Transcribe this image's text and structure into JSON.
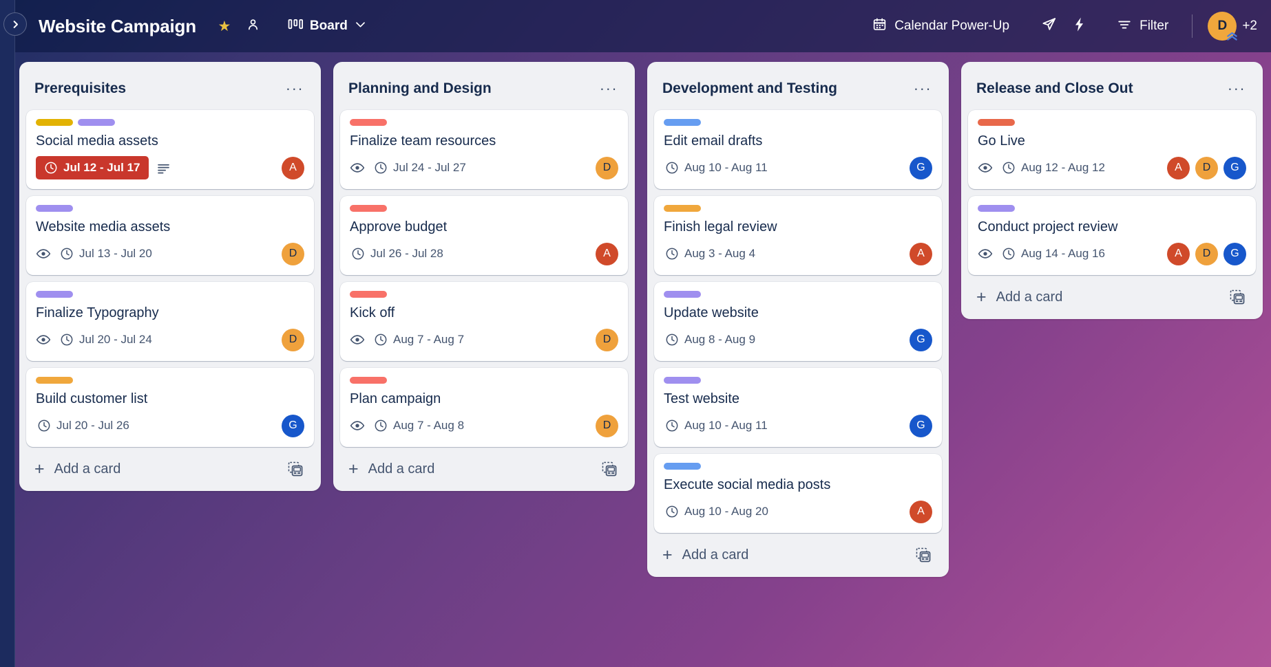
{
  "header": {
    "board_title": "Website Campaign",
    "star_icon": "star-icon",
    "visibility_icon": "workspace-visible-icon",
    "view_switcher_icon": "board-view-icon",
    "view_switcher_label": "Board",
    "view_switcher_chevron": "chevron-down-icon",
    "calendar_powerup_icon": "calendar-icon",
    "calendar_powerup_label": "Calendar Power-Up",
    "rocket_icon": "rocket-icon",
    "automation_icon": "lightning-bolt-icon",
    "filter_icon": "filter-icon",
    "filter_label": "Filter",
    "avatar_initial": "D",
    "avatar_color": "#f0a73c",
    "member_overflow": "+2",
    "premium_badge_icon": "premium-chevrons-icon"
  },
  "sidebar": {
    "expand_icon": "chevron-right-icon"
  },
  "colors": {
    "label_yellow": "#e2b203",
    "label_purple": "#9f8fef",
    "label_salmon": "#f87168",
    "label_coral": "#e8684a",
    "label_orange": "#f0a73c",
    "label_blue": "#669df1",
    "avatar_red": "#d04a2a",
    "avatar_orange": "#efa13c",
    "avatar_blue": "#1757cb",
    "due_overdue_bg": "#c9372c"
  },
  "board": {
    "add_card_label": "Add a card",
    "add_card_plus": "+",
    "card_template_icon": "card-template-icon",
    "list_menu_icon": "list-actions-icon",
    "lists": [
      {
        "title": "Prerequisites",
        "cards": [
          {
            "title": "Social media assets",
            "labels": [
              "#e2b203",
              "#9f8fef"
            ],
            "watching": false,
            "due": "Jul 12 - Jul 17",
            "due_state": "overdue",
            "description": true,
            "members": [
              {
                "initial": "A",
                "color": "#d04a2a",
                "text": "#ffffff"
              }
            ]
          },
          {
            "title": "Website media assets",
            "labels": [
              "#9f8fef"
            ],
            "watching": true,
            "due": "Jul 13 - Jul 20",
            "due_state": "normal",
            "description": false,
            "members": [
              {
                "initial": "D",
                "color": "#efa13c",
                "text": "#172b4d"
              }
            ]
          },
          {
            "title": "Finalize Typography",
            "labels": [
              "#9f8fef"
            ],
            "watching": true,
            "due": "Jul 20 - Jul 24",
            "due_state": "normal",
            "description": false,
            "members": [
              {
                "initial": "D",
                "color": "#efa13c",
                "text": "#172b4d"
              }
            ]
          },
          {
            "title": "Build customer list",
            "labels": [
              "#f0a73c"
            ],
            "watching": false,
            "due": "Jul 20 - Jul 26",
            "due_state": "normal",
            "description": false,
            "members": [
              {
                "initial": "G",
                "color": "#1757cb",
                "text": "#ffffff"
              }
            ]
          }
        ]
      },
      {
        "title": "Planning and Design",
        "cards": [
          {
            "title": "Finalize team resources",
            "labels": [
              "#f87168"
            ],
            "watching": true,
            "due": "Jul 24 - Jul 27",
            "due_state": "normal",
            "description": false,
            "members": [
              {
                "initial": "D",
                "color": "#efa13c",
                "text": "#172b4d"
              }
            ]
          },
          {
            "title": "Approve budget",
            "labels": [
              "#f87168"
            ],
            "watching": false,
            "due": "Jul 26 - Jul 28",
            "due_state": "normal",
            "description": false,
            "members": [
              {
                "initial": "A",
                "color": "#d04a2a",
                "text": "#ffffff"
              }
            ]
          },
          {
            "title": "Kick off",
            "labels": [
              "#f87168"
            ],
            "watching": true,
            "due": "Aug 7 - Aug 7",
            "due_state": "normal",
            "description": false,
            "members": [
              {
                "initial": "D",
                "color": "#efa13c",
                "text": "#172b4d"
              }
            ]
          },
          {
            "title": "Plan campaign",
            "labels": [
              "#f87168"
            ],
            "watching": true,
            "due": "Aug 7 - Aug 8",
            "due_state": "normal",
            "description": false,
            "members": [
              {
                "initial": "D",
                "color": "#efa13c",
                "text": "#172b4d"
              }
            ]
          }
        ]
      },
      {
        "title": "Development and Testing",
        "cards": [
          {
            "title": "Edit email drafts",
            "labels": [
              "#669df1"
            ],
            "watching": false,
            "due": "Aug 10 - Aug 11",
            "due_state": "normal",
            "description": false,
            "members": [
              {
                "initial": "G",
                "color": "#1757cb",
                "text": "#ffffff"
              }
            ]
          },
          {
            "title": "Finish legal review",
            "labels": [
              "#f0a73c"
            ],
            "watching": false,
            "due": "Aug 3 - Aug 4",
            "due_state": "normal",
            "description": false,
            "members": [
              {
                "initial": "A",
                "color": "#d04a2a",
                "text": "#ffffff"
              }
            ]
          },
          {
            "title": "Update website",
            "labels": [
              "#9f8fef"
            ],
            "watching": false,
            "due": "Aug 8 - Aug 9",
            "due_state": "normal",
            "description": false,
            "members": [
              {
                "initial": "G",
                "color": "#1757cb",
                "text": "#ffffff"
              }
            ]
          },
          {
            "title": "Test website",
            "labels": [
              "#9f8fef"
            ],
            "watching": false,
            "due": "Aug 10 - Aug 11",
            "due_state": "normal",
            "description": false,
            "members": [
              {
                "initial": "G",
                "color": "#1757cb",
                "text": "#ffffff"
              }
            ]
          },
          {
            "title": "Execute social media posts",
            "labels": [
              "#669df1"
            ],
            "watching": false,
            "due": "Aug 10 - Aug 20",
            "due_state": "normal",
            "description": false,
            "members": [
              {
                "initial": "A",
                "color": "#d04a2a",
                "text": "#ffffff"
              }
            ]
          }
        ]
      },
      {
        "title": "Release and Close Out",
        "cards": [
          {
            "title": "Go Live",
            "labels": [
              "#e8684a"
            ],
            "watching": true,
            "due": "Aug 12 - Aug 12",
            "due_state": "normal",
            "description": false,
            "members": [
              {
                "initial": "A",
                "color": "#d04a2a",
                "text": "#ffffff"
              },
              {
                "initial": "D",
                "color": "#efa13c",
                "text": "#172b4d"
              },
              {
                "initial": "G",
                "color": "#1757cb",
                "text": "#ffffff"
              }
            ]
          },
          {
            "title": "Conduct project review",
            "labels": [
              "#9f8fef"
            ],
            "watching": true,
            "due": "Aug 14 - Aug 16",
            "due_state": "normal",
            "description": false,
            "members": [
              {
                "initial": "A",
                "color": "#d04a2a",
                "text": "#ffffff"
              },
              {
                "initial": "D",
                "color": "#efa13c",
                "text": "#172b4d"
              },
              {
                "initial": "G",
                "color": "#1757cb",
                "text": "#ffffff"
              }
            ]
          }
        ]
      }
    ]
  }
}
